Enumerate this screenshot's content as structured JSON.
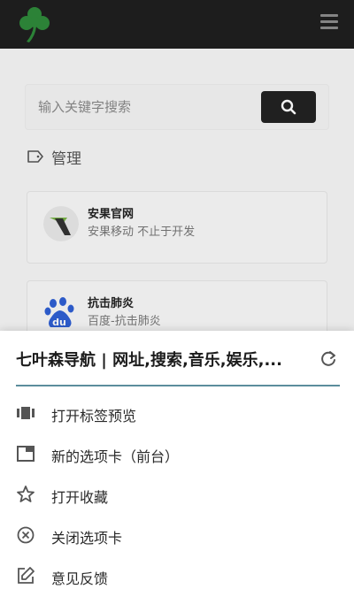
{
  "search": {
    "placeholder": "输入关键字搜索"
  },
  "section": {
    "label": "管理"
  },
  "cards": [
    {
      "title": "安果官网",
      "desc": "安果移动 不止于开发"
    },
    {
      "title": "抗击肺炎",
      "desc": "百度-抗击肺炎"
    }
  ],
  "sheet": {
    "title": "七叶森导航 | 网址,搜索,音乐,娱乐,...",
    "items": [
      {
        "label": "打开标签预览",
        "icon": "tab-preview-icon"
      },
      {
        "label": "新的选项卡（前台）",
        "icon": "new-tab-icon"
      },
      {
        "label": "打开收藏",
        "icon": "star-icon"
      },
      {
        "label": "关闭选项卡",
        "icon": "close-circle-icon"
      },
      {
        "label": "意见反馈",
        "icon": "edit-icon"
      }
    ]
  },
  "colors": {
    "topbar": "#1f1f1f",
    "accent_divider": "#5b8d9c",
    "logo_green": "#2f8a3a"
  }
}
